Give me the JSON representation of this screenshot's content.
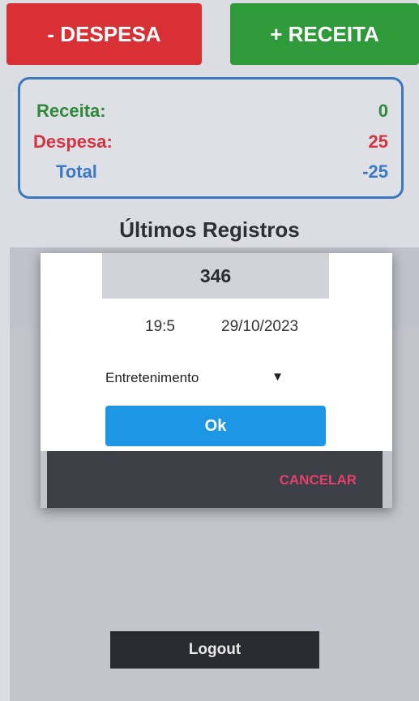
{
  "actions": {
    "despesa_label": "- DESPESA",
    "receita_label": "+ RECEITA"
  },
  "summary": {
    "receita_label": "Receita:",
    "receita_value": "0",
    "despesa_label": "Despesa:",
    "despesa_value": "25",
    "total_label": "Total",
    "total_value": "-25"
  },
  "records": {
    "title": "Últimos Registros"
  },
  "dialog": {
    "amount": "346",
    "time": "19:5",
    "date": "29/10/2023",
    "category": "Entretenimento",
    "ok_label": "Ok",
    "cancel_label": "CANCELAR"
  },
  "footer": {
    "logout_label": "Logout"
  },
  "colors": {
    "despesa": "#d93035",
    "receita": "#2e9a3a",
    "accent_blue": "#1e96e6",
    "cancel_pink": "#e4406b"
  }
}
